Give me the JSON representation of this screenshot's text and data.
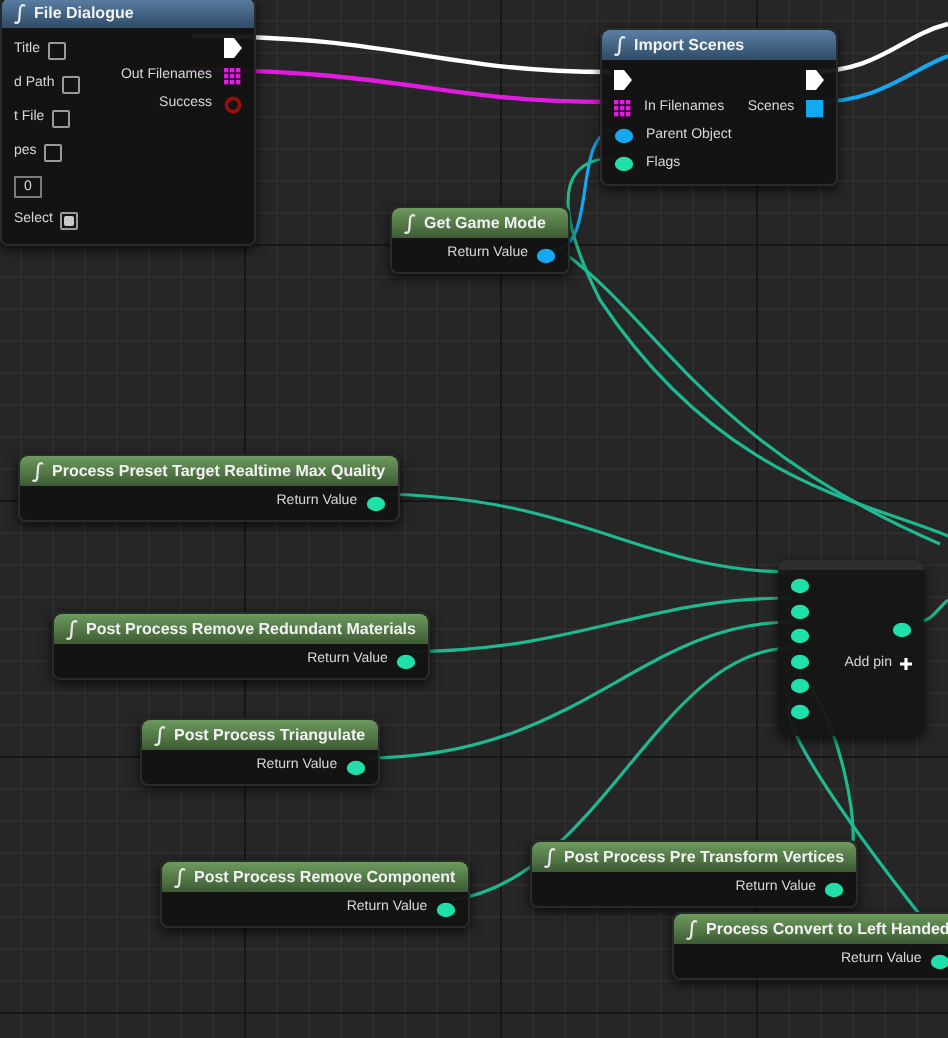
{
  "nodes": [
    {
      "kind": "function",
      "title": "File Dialogue",
      "inputs": [
        {
          "kind": "checkbox",
          "label": "Title",
          "checked": false
        },
        {
          "kind": "checkbox",
          "label": "d Path",
          "checked": false
        },
        {
          "kind": "checkbox",
          "label": "t File",
          "checked": false
        },
        {
          "kind": "checkbox",
          "label": "pes",
          "checked": false
        },
        {
          "kind": "number",
          "value": "0"
        },
        {
          "kind": "checkbox",
          "label": "Select",
          "checked": true
        }
      ],
      "outputs": [
        {
          "kind": "exec"
        },
        {
          "kind": "array",
          "label": "Out Filenames"
        },
        {
          "kind": "bool",
          "label": "Success"
        }
      ]
    },
    {
      "kind": "function",
      "title": "Import Scenes",
      "inputs": [
        {
          "kind": "exec"
        },
        {
          "kind": "array",
          "label": "In Filenames"
        },
        {
          "kind": "object",
          "label": "Parent Object"
        },
        {
          "kind": "int",
          "label": "Flags"
        }
      ],
      "outputs": [
        {
          "kind": "exec"
        },
        {
          "kind": "object_array",
          "label": "Scenes"
        }
      ]
    },
    {
      "kind": "pure",
      "title": "Get Game Mode",
      "outputs": [
        {
          "kind": "object",
          "label": "Return Value"
        }
      ]
    },
    {
      "kind": "pure",
      "title": "Process Preset Target Realtime Max Quality",
      "outputs": [
        {
          "kind": "int",
          "label": "Return Value"
        }
      ]
    },
    {
      "kind": "pure",
      "title": "Post Process Remove Redundant Materials",
      "outputs": [
        {
          "kind": "int",
          "label": "Return Value"
        }
      ]
    },
    {
      "kind": "pure",
      "title": "Post Process Triangulate",
      "outputs": [
        {
          "kind": "int",
          "label": "Return Value"
        }
      ]
    },
    {
      "kind": "make_array",
      "inputs": [
        {
          "kind": "int"
        },
        {
          "kind": "int"
        },
        {
          "kind": "int"
        },
        {
          "kind": "int"
        },
        {
          "kind": "int"
        },
        {
          "kind": "int"
        }
      ],
      "outputs": [
        {
          "kind": "int"
        }
      ],
      "add_pin": "Add pin"
    },
    {
      "kind": "pure",
      "title": "Post Process Pre Transform Vertices",
      "outputs": [
        {
          "kind": "int",
          "label": "Return Value"
        }
      ]
    },
    {
      "kind": "pure",
      "title": "Post Process Remove Component",
      "outputs": [
        {
          "kind": "int",
          "label": "Return Value"
        }
      ]
    },
    {
      "kind": "pure",
      "title": "Process Convert to Left Handed",
      "outputs": [
        {
          "kind": "int",
          "label": "Return Value"
        }
      ]
    }
  ]
}
